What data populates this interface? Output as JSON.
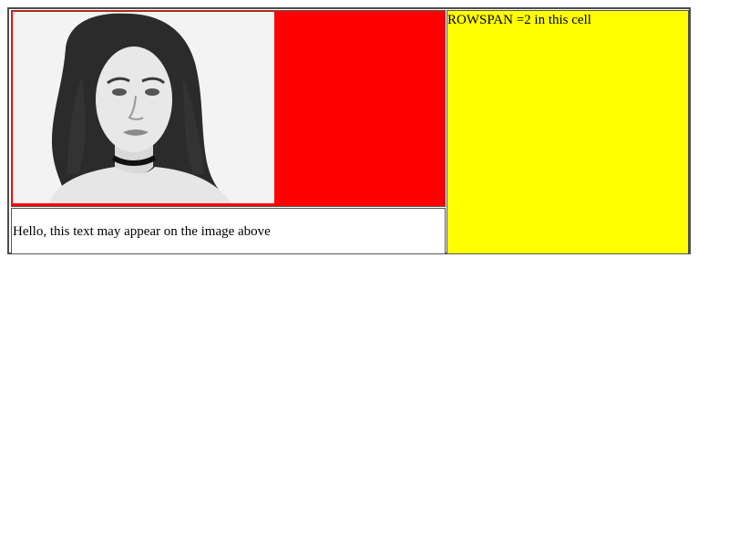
{
  "table": {
    "image_cell": {
      "background": "#ff0000",
      "image": "portrait-photo"
    },
    "caption_cell": {
      "text": "Hello, this text may appear on the image above",
      "background": "#ffffff"
    },
    "rowspan_cell": {
      "text": "ROWSPAN =2 in this cell",
      "background": "#ffff00"
    }
  }
}
